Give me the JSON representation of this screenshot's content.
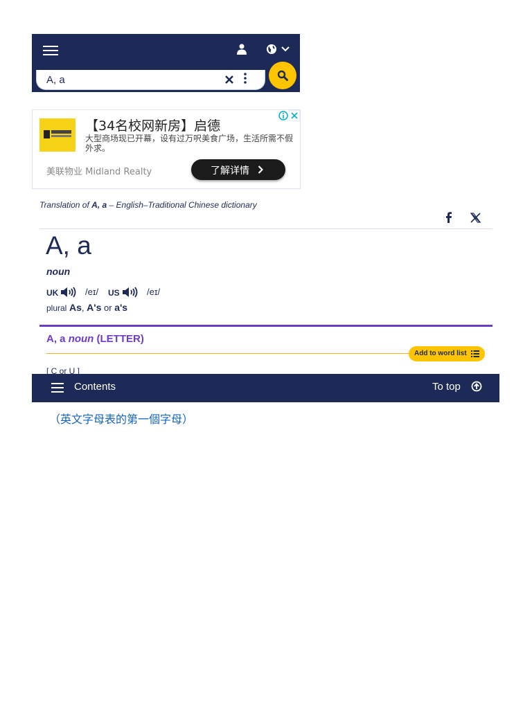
{
  "search": {
    "value": "A, a"
  },
  "ad": {
    "title": "【34名校网新房】启德",
    "description": "大型商场现已开幕，设有过万呎美食广场，生活所需不假外求。",
    "brand": "美联物业 Midland Realty",
    "cta": "了解详情"
  },
  "translation_header": {
    "prefix": "Translation of ",
    "word": "A, a",
    "suffix": " – English–Traditional Chinese dictionary"
  },
  "entry": {
    "headword": "A, a",
    "pos": "noun",
    "uk_label": "UK",
    "uk_pron": "/eɪ/",
    "us_label": "US",
    "us_pron": "/eɪ/",
    "plural_label": "plural",
    "plural_1": "As",
    "plural_sep": ",",
    "plural_2": "A's",
    "plural_or": "or",
    "plural_3": "a's",
    "sense_word": "A, a",
    "sense_pos": "noun",
    "sense_guide": "(LETTER)",
    "add_to_word_list": "Add to word list",
    "grammar": "[ C or U ]",
    "translation": "（英文字母表的第一個字母）"
  },
  "bottom_bar": {
    "contents": "Contents",
    "to_top": "To top"
  },
  "colors": {
    "navy": "#1d2a57",
    "accent_yellow": "#fec400",
    "purple": "#6c3bc7",
    "link_blue": "#1565c0"
  }
}
